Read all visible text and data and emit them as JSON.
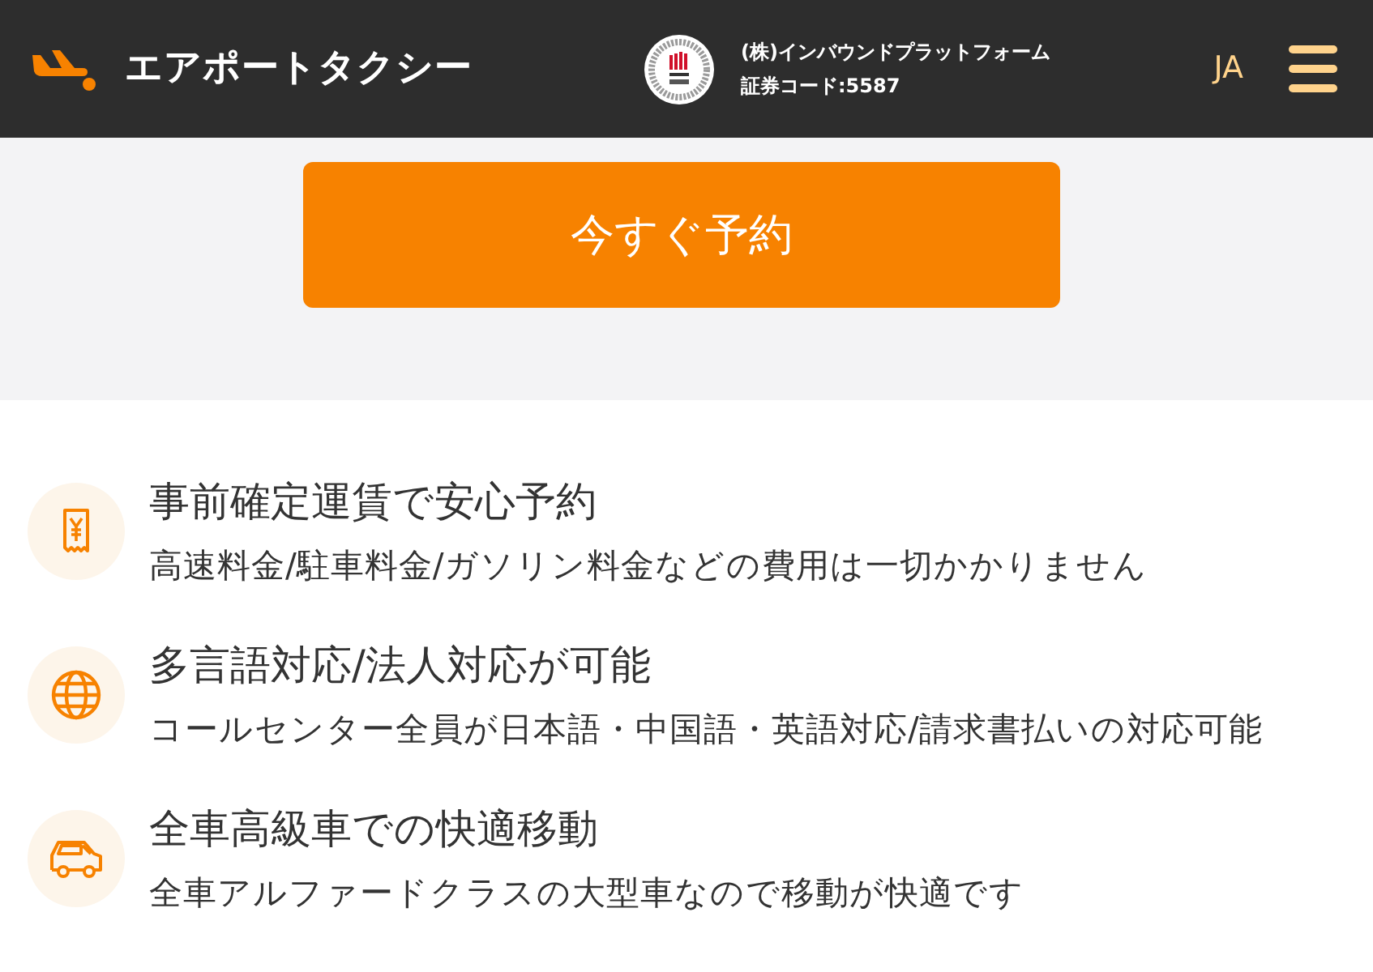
{
  "header": {
    "logo": {
      "title": "エアポートタクシー"
    },
    "company": {
      "name": "(株)インバウンドプラットフォーム",
      "code": "証券コード:5587"
    },
    "language": "JA"
  },
  "cta": {
    "label": "今すぐ予約"
  },
  "features": [
    {
      "kind": "receipt",
      "title": "事前確定運賃で安心予約",
      "description": "高速料金/駐車料金/ガソリン料金などの費用は一切かかりません"
    },
    {
      "kind": "globe",
      "title": "多言語対応/法人対応が可能",
      "description": "コールセンター全員が日本語・中国語・英語対応/請求書払いの対応可能"
    },
    {
      "kind": "car",
      "title": "全車高級車での快適移動",
      "description": "全車アルファードクラスの大型車なので移動が快適です"
    }
  ]
}
